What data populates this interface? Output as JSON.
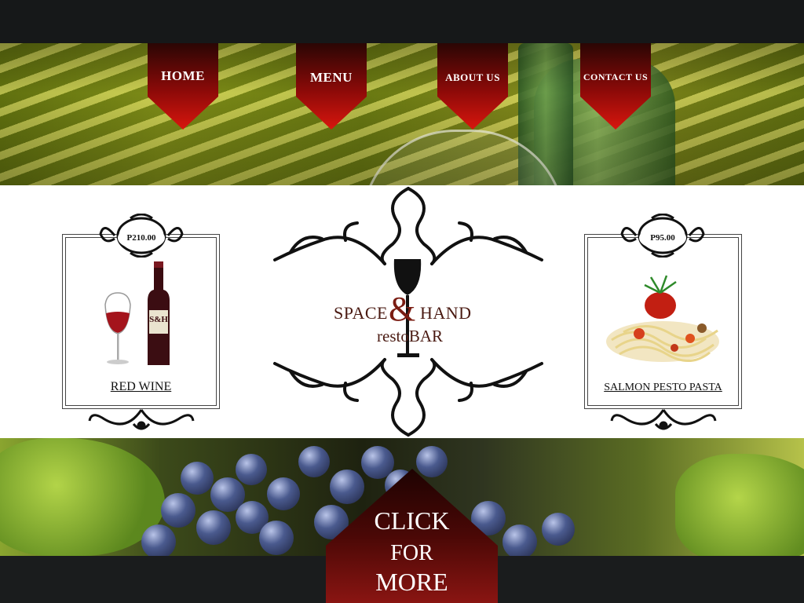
{
  "nav": {
    "items": [
      {
        "label": "HOME"
      },
      {
        "label": "MENU"
      },
      {
        "label": "ABOUT US"
      },
      {
        "label": "CONTACT US"
      }
    ]
  },
  "logo": {
    "line1_left": "SPACE",
    "ampersand": "&",
    "line1_right": "HAND",
    "line2": "restoBAR"
  },
  "featured": [
    {
      "price": "P210.00",
      "name": "RED WINE",
      "bottle_label": "S&H"
    },
    {
      "price": "P95.00",
      "name": "SALMON PESTO PASTA"
    }
  ],
  "cta": {
    "line1": "CLICK",
    "line2": "FOR",
    "line3": "MORE"
  },
  "colors": {
    "ribbon_top": "#2a0604",
    "ribbon_bottom": "#c9120c",
    "cta_top": "#1e0302",
    "cta_bottom": "#8a1512"
  }
}
